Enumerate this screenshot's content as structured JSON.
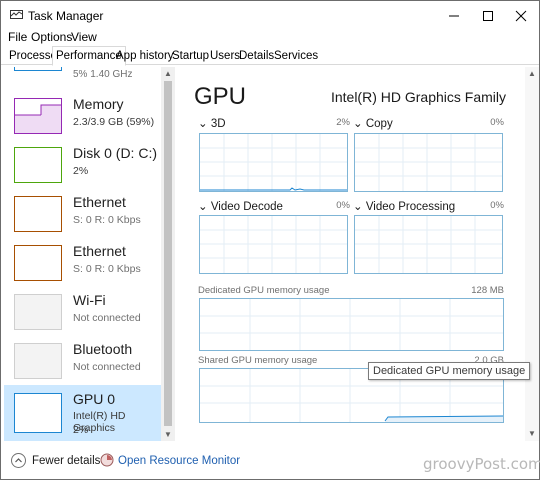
{
  "window": {
    "title": "Task Manager"
  },
  "menu": [
    "File",
    "Options",
    "View"
  ],
  "tabs": [
    "Processes",
    "Performance",
    "App history",
    "Startup",
    "Users",
    "Details",
    "Services"
  ],
  "active_tab": "Performance",
  "left_list": {
    "partial_top_text": "5% 1.40 GHz",
    "items": [
      {
        "name": "Memory",
        "sub1": "2.3/3.9 GB (59%)",
        "sub2": "",
        "color": "#9528b4"
      },
      {
        "name": "Disk 0 (D: C:)",
        "sub1": "2%",
        "sub2": "",
        "color": "#4da60c"
      },
      {
        "name": "Ethernet",
        "sub1": "S: 0 R: 0 Kbps",
        "sub2": "",
        "color": "#a74f01"
      },
      {
        "name": "Ethernet",
        "sub1": "S: 0 R: 0 Kbps",
        "sub2": "",
        "color": "#a74f01"
      },
      {
        "name": "Wi-Fi",
        "sub1": "Not connected",
        "sub2": "",
        "color": "#cfcfcf"
      },
      {
        "name": "Bluetooth",
        "sub1": "Not connected",
        "sub2": "",
        "color": "#cfcfcf"
      },
      {
        "name": "GPU 0",
        "sub1": "Intel(R) HD Graphics",
        "sub2": "2%",
        "color": "#1c86d1"
      }
    ],
    "selected_item": "GPU 0"
  },
  "gpu": {
    "title": "GPU",
    "adapter": "Intel(R) HD Graphics Family",
    "engines": [
      {
        "label": "3D",
        "percent": "2%"
      },
      {
        "label": "Copy",
        "percent": "0%"
      },
      {
        "label": "Video Decode",
        "percent": "0%"
      },
      {
        "label": "Video Processing",
        "percent": "0%"
      }
    ],
    "dedicated_label": "Dedicated GPU memory usage",
    "dedicated_max": "128 MB",
    "shared_label": "Shared GPU memory usage",
    "shared_max": "2.0 GB",
    "tooltip": "Dedicated GPU memory usage"
  },
  "footer": {
    "fewer_details": "Fewer details",
    "resource_monitor": "Open Resource Monitor"
  },
  "watermark": "groovyPost.com",
  "colors": {
    "graph_border": "#7fb5d6",
    "graph_line": "#1c86d1",
    "selected_bg": "#cce8ff",
    "link": "#2060b0"
  }
}
